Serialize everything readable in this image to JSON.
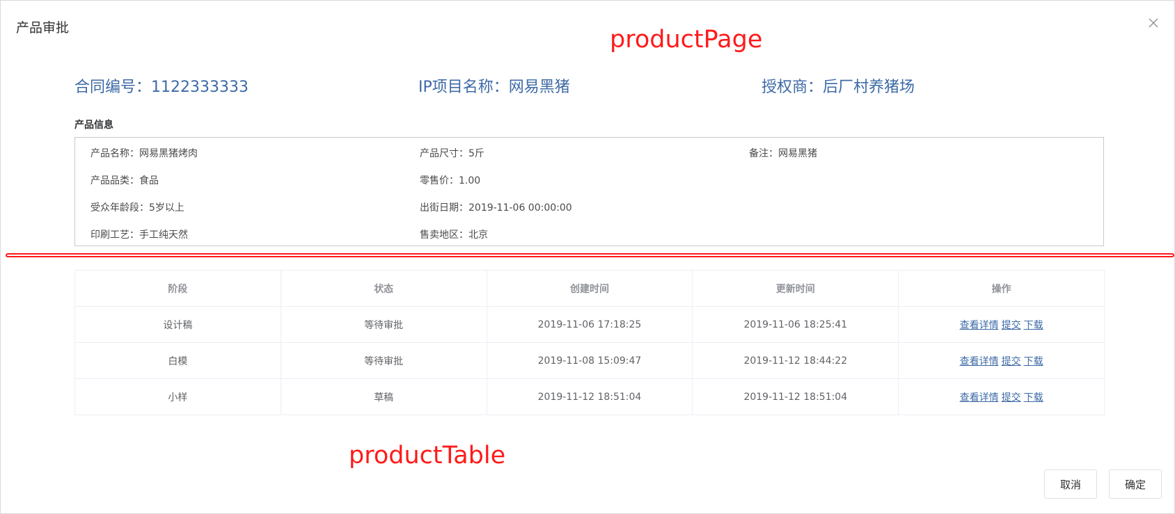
{
  "dialog": {
    "title": "产品审批",
    "cancel_label": "取消",
    "confirm_label": "确定"
  },
  "annotations": {
    "page_label": "productPage",
    "table_label": "productTable"
  },
  "summary": {
    "contract": "合同编号：1122333333",
    "ip_project": "IP项目名称：网易黑猪",
    "licensor": "授权商：后厂村养猪场"
  },
  "product_info": {
    "section_title": "产品信息",
    "name": "产品名称：网易黑猪烤肉",
    "size": "产品尺寸：5斤",
    "remark": "备注：网易黑猪",
    "category": "产品品类：食品",
    "retail_price": "零售价：1.00",
    "age_group": "受众年龄段：5岁以上",
    "release_date": "出街日期：2019-11-06 00:00:00",
    "printing": "印刷工艺：手工纯天然",
    "sales_region": "售卖地区：北京"
  },
  "table": {
    "headers": [
      "阶段",
      "状态",
      "创建时间",
      "更新时间",
      "操作"
    ],
    "rows": [
      {
        "stage": "设计稿",
        "status": "等待审批",
        "created": "2019-11-06 17:18:25",
        "updated": "2019-11-06 18:25:41"
      },
      {
        "stage": "白模",
        "status": "等待审批",
        "created": "2019-11-08 15:09:47",
        "updated": "2019-11-12 18:44:22"
      },
      {
        "stage": "小样",
        "status": "草稿",
        "created": "2019-11-12 18:51:04",
        "updated": "2019-11-12 18:51:04"
      }
    ],
    "actions": {
      "view": "查看详情",
      "submit": "提交",
      "download": "下载"
    }
  },
  "icons": {
    "close": "close-icon"
  },
  "colors": {
    "accent": "#3d6aa5",
    "annotation": "#ff1a1a"
  }
}
